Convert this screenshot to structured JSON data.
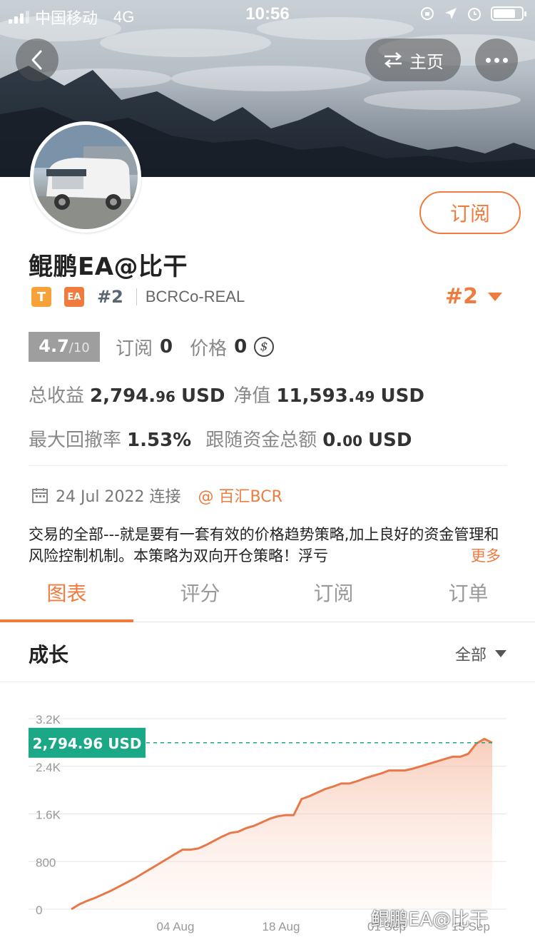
{
  "status_bar": {
    "carrier": "中国移动",
    "network": "4G",
    "time": "10:56"
  },
  "nav": {
    "home_label": "主页"
  },
  "profile": {
    "subscribe_label": "订阅",
    "name": "鲲鹏EA@比干",
    "badge_t": "T",
    "badge_ea": "EA",
    "rank_small": "#2",
    "server": "BCRCo-REAL",
    "rank_big": "#2",
    "score": "4.7",
    "score_den": "/10",
    "subs_label": "订阅",
    "subs_value": "0",
    "price_label": "价格",
    "price_value": "0",
    "coin_symbol": "$",
    "profit_label": "总收益",
    "profit_int": "2,794.",
    "profit_dec": "96",
    "profit_unit": "USD",
    "equity_label": "净值",
    "equity_int": "11,593.",
    "equity_dec": "49",
    "equity_unit": "USD",
    "drawdown_label": "最大回撤率",
    "drawdown_value": "1.53%",
    "follow_label": "跟随资金总额",
    "follow_int": "0.",
    "follow_dec": "00",
    "follow_unit": "USD",
    "date_text": "24 Jul 2022 连接",
    "broker": "@ 百汇BCR",
    "description": "交易的全部---就是要有一套有效的价格趋势策略,加上良好的资金管理和风险控制机制。本策略为双向开仓策略！浮亏",
    "more": "更多"
  },
  "tabs": [
    {
      "label": "图表"
    },
    {
      "label": "评分"
    },
    {
      "label": "订阅"
    },
    {
      "label": "订单"
    }
  ],
  "section": {
    "title": "成长",
    "range": "全部"
  },
  "chart_data": {
    "type": "area",
    "current_label": "2,794.96 USD",
    "current_value": 2794.96,
    "yticks": [
      "3.2K",
      "2.4K",
      "1.6K",
      "800",
      "0"
    ],
    "ytick_values": [
      3200,
      2400,
      1600,
      800,
      0
    ],
    "xticks": [
      "04 Aug",
      "18 Aug",
      "01 Sep",
      "15 Sep"
    ],
    "ylim": [
      0,
      3200
    ],
    "series": [
      {
        "values": [
          0,
          80,
          140,
          190,
          250,
          310,
          380,
          450,
          520,
          600,
          680,
          760,
          840,
          920,
          1000,
          1000,
          1020,
          1080,
          1150,
          1220,
          1280,
          1300,
          1360,
          1400,
          1460,
          1520,
          1560,
          1580,
          1580,
          1850,
          1900,
          1960,
          2020,
          2060,
          2110,
          2110,
          2150,
          2200,
          2240,
          2280,
          2330,
          2330,
          2330,
          2360,
          2400,
          2440,
          2480,
          2520,
          2560,
          2560,
          2610,
          2780,
          2860,
          2794.96
        ]
      }
    ],
    "color": "#e8784a"
  },
  "watermark": "鲲鹏EA@比干",
  "colors": {
    "accent": "#f07b3f",
    "positive_label": "#1aa886"
  }
}
